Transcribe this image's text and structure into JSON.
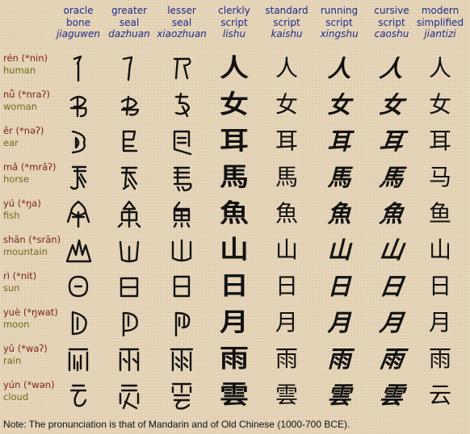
{
  "columns": [
    {
      "line1": "oracle",
      "line2": "bone",
      "pinyin": "jiaguwen"
    },
    {
      "line1": "greater",
      "line2": "seal",
      "pinyin": "dazhuan"
    },
    {
      "line1": "lesser",
      "line2": "seal",
      "pinyin": "xiaozhuan"
    },
    {
      "line1": "clerkly",
      "line2": "script",
      "pinyin": "lishu"
    },
    {
      "line1": "standard",
      "line2": "script",
      "pinyin": "kaishu"
    },
    {
      "line1": "running",
      "line2": "script",
      "pinyin": "xingshu"
    },
    {
      "line1": "cursive",
      "line2": "script",
      "pinyin": "caoshu"
    },
    {
      "line1": "modern",
      "line2": "simplified",
      "pinyin": "jiantizi"
    }
  ],
  "rows": [
    {
      "pron": "rén (*nin)",
      "meaning": "human",
      "traditional": "人",
      "simplified": "人"
    },
    {
      "pron": "nǚ (*nraʔ)",
      "meaning": "woman",
      "traditional": "女",
      "simplified": "女"
    },
    {
      "pron": "ěr (*nəʔ)",
      "meaning": "ear",
      "traditional": "耳",
      "simplified": "耳"
    },
    {
      "pron": "mǎ (*mrāʔ)",
      "meaning": "horse",
      "traditional": "馬",
      "simplified": "马"
    },
    {
      "pron": "yú (*ŋa)",
      "meaning": "fish",
      "traditional": "魚",
      "simplified": "鱼"
    },
    {
      "pron": "shān (*srān)",
      "meaning": "mountain",
      "traditional": "山",
      "simplified": "山"
    },
    {
      "pron": "rì (*nit)",
      "meaning": "sun",
      "traditional": "日",
      "simplified": "日"
    },
    {
      "pron": "yuè (*ŋwat)",
      "meaning": "moon",
      "traditional": "月",
      "simplified": "月"
    },
    {
      "pron": "yǔ (*waʔ)",
      "meaning": "rain",
      "traditional": "雨",
      "simplified": "雨"
    },
    {
      "pron": "yún (*wən)",
      "meaning": "cloud",
      "traditional": "雲",
      "simplified": "云"
    }
  ],
  "note": "Note: The pronunciation is that of Mandarin and of Old Chinese (1000-700 BCE).",
  "colors": {
    "header": "#1e2a8c",
    "pronunciation": "#7a1f1a",
    "meaning": "#6e6a1a",
    "background": "#e4d2b4"
  }
}
